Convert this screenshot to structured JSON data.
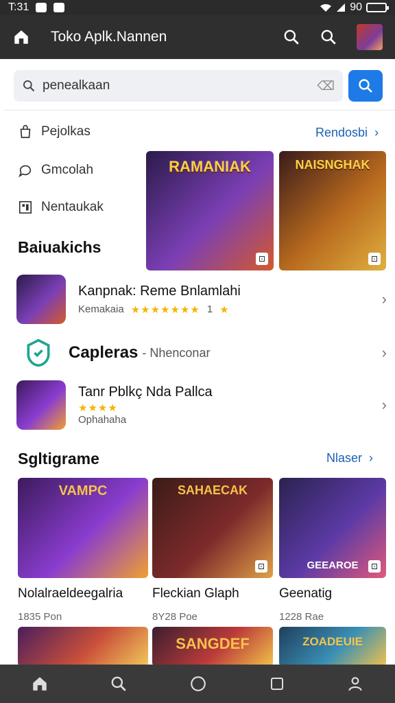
{
  "status": {
    "time": "T:31",
    "battery": "90"
  },
  "appbar": {
    "title": "Toko Aplk.Nannen"
  },
  "search": {
    "value": "penealkaan",
    "clear_icon": "clear-icon"
  },
  "categories": [
    {
      "label": "Pejolkas",
      "icon": "bag-icon"
    },
    {
      "label": "Gmcolah",
      "icon": "chat-icon"
    },
    {
      "label": "Nentaukak",
      "icon": "grid-icon"
    }
  ],
  "top_link": "Rendosbi",
  "featured": {
    "heading": "Baiuakichs",
    "tiles": [
      {
        "title": "RAMANIAK",
        "colors": [
          "#2b1b4a",
          "#7b3fb5",
          "#d45a2b"
        ]
      },
      {
        "title": "NAISNGHAK",
        "colors": [
          "#3a1b1b",
          "#b86a1e",
          "#e0b040"
        ]
      }
    ]
  },
  "list": [
    {
      "name": "Kanpnak: Reme Bnlamlahi",
      "sub": "Kemakaia",
      "stars": "★★★★★★★",
      "count": "1",
      "tail": "★"
    },
    {
      "name": "Capleras",
      "sub": "",
      "suffix": "- Nhenconar"
    },
    {
      "name": "Tanr Pblkç Nda Pallca",
      "sub": "Ophahaha",
      "stars": "★★★★"
    }
  ],
  "spotlight": {
    "heading": "Sgltigrame",
    "link": "Nlaser",
    "cards": [
      {
        "name": "Nolalraeldeegalria",
        "meta": "1835 Pon",
        "art_text": "VAMPC",
        "colors": [
          "#3c1b5c",
          "#8a3ccf",
          "#f0a030"
        ]
      },
      {
        "name": "Fleckian Glaph",
        "meta": "8Y28 Poe",
        "art_text": "SAHAECAK",
        "colors": [
          "#3a1c18",
          "#7c2a2a",
          "#e0a048"
        ]
      },
      {
        "name": "Geenatig",
        "meta": "1228 Rae",
        "art_text": "GEEAROE",
        "colors": [
          "#2c2250",
          "#5b3aa6",
          "#e05a7a"
        ]
      }
    ],
    "bottom_art": [
      {
        "colors": [
          "#4a1f5e",
          "#c94f3a",
          "#f2c85a"
        ]
      },
      {
        "text": "SANGDEF",
        "colors": [
          "#3a1f2f",
          "#bb3a3a",
          "#f1c24a"
        ]
      },
      {
        "text": "ZOADEUIE",
        "colors": [
          "#1f3f5c",
          "#3a8fb5",
          "#f1c24a"
        ]
      }
    ]
  },
  "nav": [
    "home-icon",
    "search-icon",
    "circle-icon",
    "square-icon",
    "profile-icon"
  ]
}
